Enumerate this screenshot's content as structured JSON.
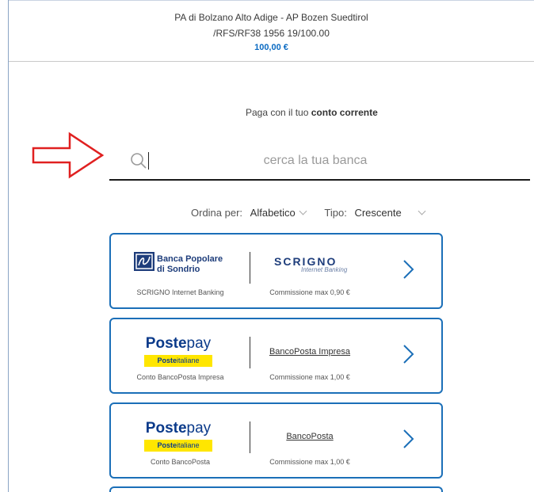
{
  "header": {
    "payee": "PA di Bolzano Alto Adige - AP Bozen Suedtirol",
    "reference": "/RFS/RF38 1956 19/100.00",
    "amount": "100,00 €"
  },
  "title": {
    "prefix": "Paga con il tuo",
    "bold": "conto corrente"
  },
  "search": {
    "placeholder": "cerca la tua banca",
    "value": ""
  },
  "sort": {
    "label": "Ordina per:",
    "value": "Alfabetico",
    "type_label": "Tipo:",
    "type_value": "Crescente"
  },
  "banks": [
    {
      "logo_line1": "Banca Popolare",
      "logo_line2": "di Sondrio",
      "service_logo": "SCRIGNO",
      "service_logo_tagline": "Internet Banking",
      "left_caption": "SCRIGNO Internet Banking",
      "right_caption": "Commissione max 0,90 €"
    },
    {
      "logo_word_bold": "Poste",
      "logo_word_light": "pay",
      "logo_band_bold": "Poste",
      "logo_band_light": "italiane",
      "product": "BancoPosta Impresa",
      "left_caption": "Conto BancoPosta Impresa",
      "right_caption": "Commissione max 1,00 €"
    },
    {
      "logo_word_bold": "Poste",
      "logo_word_light": "pay",
      "logo_band_bold": "Poste",
      "logo_band_light": "italiane",
      "product": "BancoPosta",
      "left_caption": "Conto BancoPosta",
      "right_caption": "Commissione max 1,00 €"
    }
  ],
  "colors": {
    "accent": "#1b6fb8",
    "amount": "#0a6ac2",
    "annotation_arrow": "#e02020",
    "postepay_yellow": "#ffe600"
  },
  "icons": {
    "search": "search-icon",
    "chevron": "chevron-right-icon",
    "annotation": "red-arrow-icon"
  }
}
